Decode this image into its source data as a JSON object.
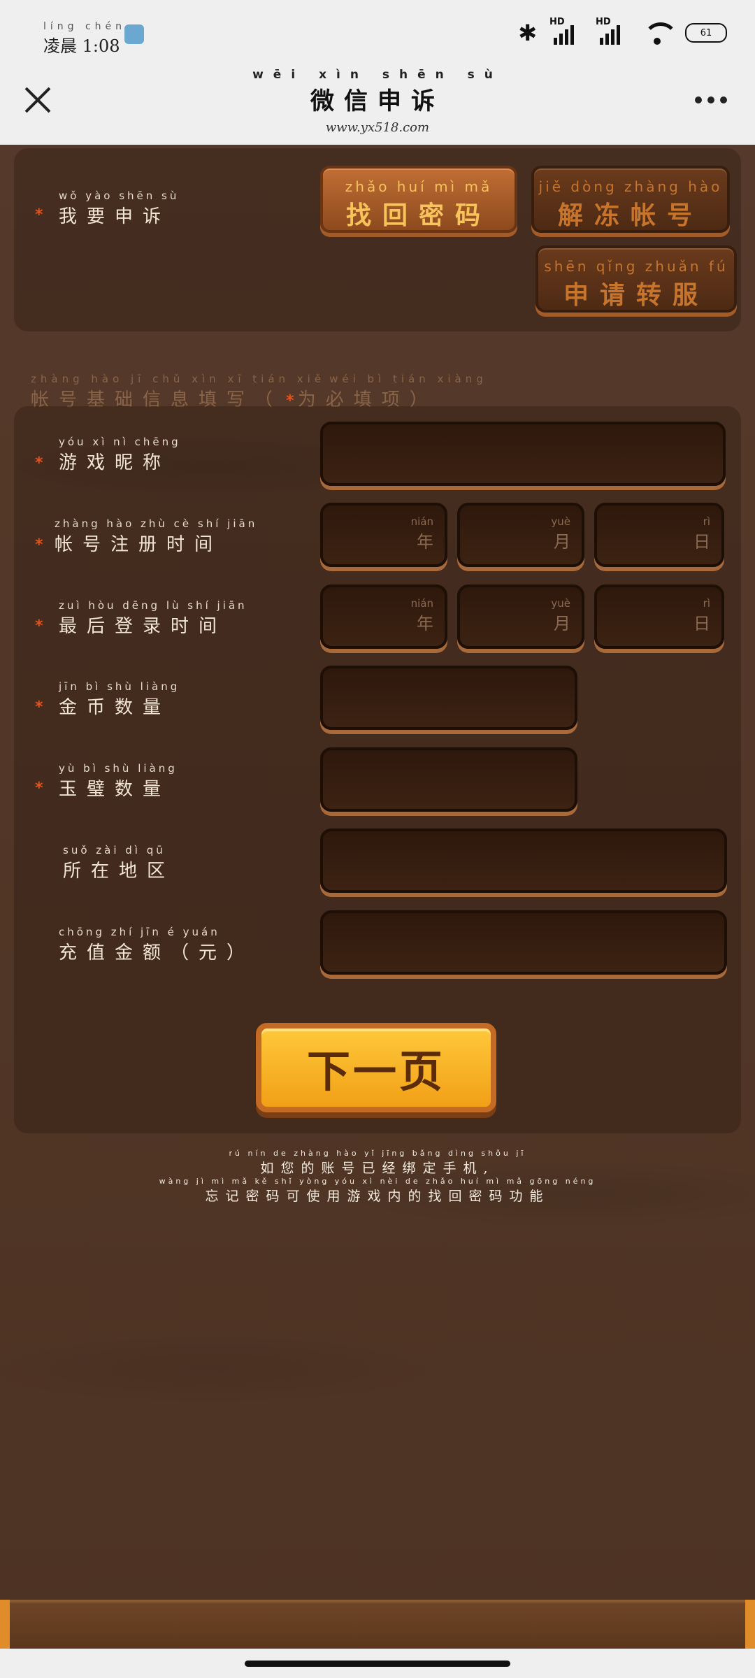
{
  "status_bar": {
    "time_pinyin": "líng chén",
    "time": "凌晨 1:08",
    "network_1": "HD",
    "network_2": "HD",
    "battery": "61",
    "icons": [
      "bluetooth-icon",
      "signal-icon",
      "wifi-icon",
      "battery-icon"
    ]
  },
  "header": {
    "title_pinyin": "wēi xìn shēn sù",
    "title": "微信申诉",
    "url": "www.yx518.com"
  },
  "appeal_type": {
    "label_pinyin": "wǒ yào shēn sù",
    "label": "我要申诉",
    "buttons": [
      {
        "pinyin": "zhǎo huí mì mǎ",
        "label": "找回密码",
        "active": true
      },
      {
        "pinyin": "jiě dòng zhàng hào",
        "label": "解冻帐号",
        "active": false
      },
      {
        "pinyin": "shēn qǐng zhuǎn fú",
        "label": "申请转服",
        "active": false
      }
    ]
  },
  "section": {
    "title_pinyin": "zhàng hào jī chǔ xìn xī tián xiě",
    "title": "帐号基础信息填写（",
    "required_pinyin": "wéi bì tián xiàng",
    "required_note": "为必填项）",
    "required_mark": "*"
  },
  "fields": [
    {
      "pinyin": "yóu xì nì chēng",
      "label": "游戏昵称",
      "required": true
    },
    {
      "pinyin": "zhàng hào zhù cè shí jiān",
      "label": "帐号注册时间",
      "required": true
    },
    {
      "pinyin": "zuì hòu dēng lù shí jiān",
      "label": "最后登录时间",
      "required": true
    },
    {
      "pinyin": "jīn bì shù liàng",
      "label": "金币数量",
      "required": true
    },
    {
      "pinyin": "yù bì shù liàng",
      "label": "玉璧数量",
      "required": true
    },
    {
      "pinyin": "suǒ zài dì qū",
      "label": "所在地区",
      "required": false
    },
    {
      "pinyin": "chōng zhí jīn é yuán",
      "label": "充值金额（元）",
      "required": false
    }
  ],
  "date_units": [
    {
      "pinyin": "nián",
      "label": "年"
    },
    {
      "pinyin": "yuè",
      "label": "月"
    },
    {
      "pinyin": "rì",
      "label": "日"
    }
  ],
  "next_button": "下一页",
  "notice": {
    "line1_pinyin": "rú nín de zhàng hào yǐ jīng bǎng dìng shǒu jī",
    "line1": "如您的账号已经绑定手机,",
    "line2_pinyin": "wàng jì mì mǎ kě shǐ yòng yóu xì nèi de zhǎo huí mì mǎ gōng néng",
    "line2": "忘记密码可使用游戏内的找回密码功能"
  },
  "colors": {
    "accent_orange": "#f7c35b",
    "required_star": "#e8531c",
    "next_button": "#ffc83a",
    "wood": "#4e3424"
  }
}
